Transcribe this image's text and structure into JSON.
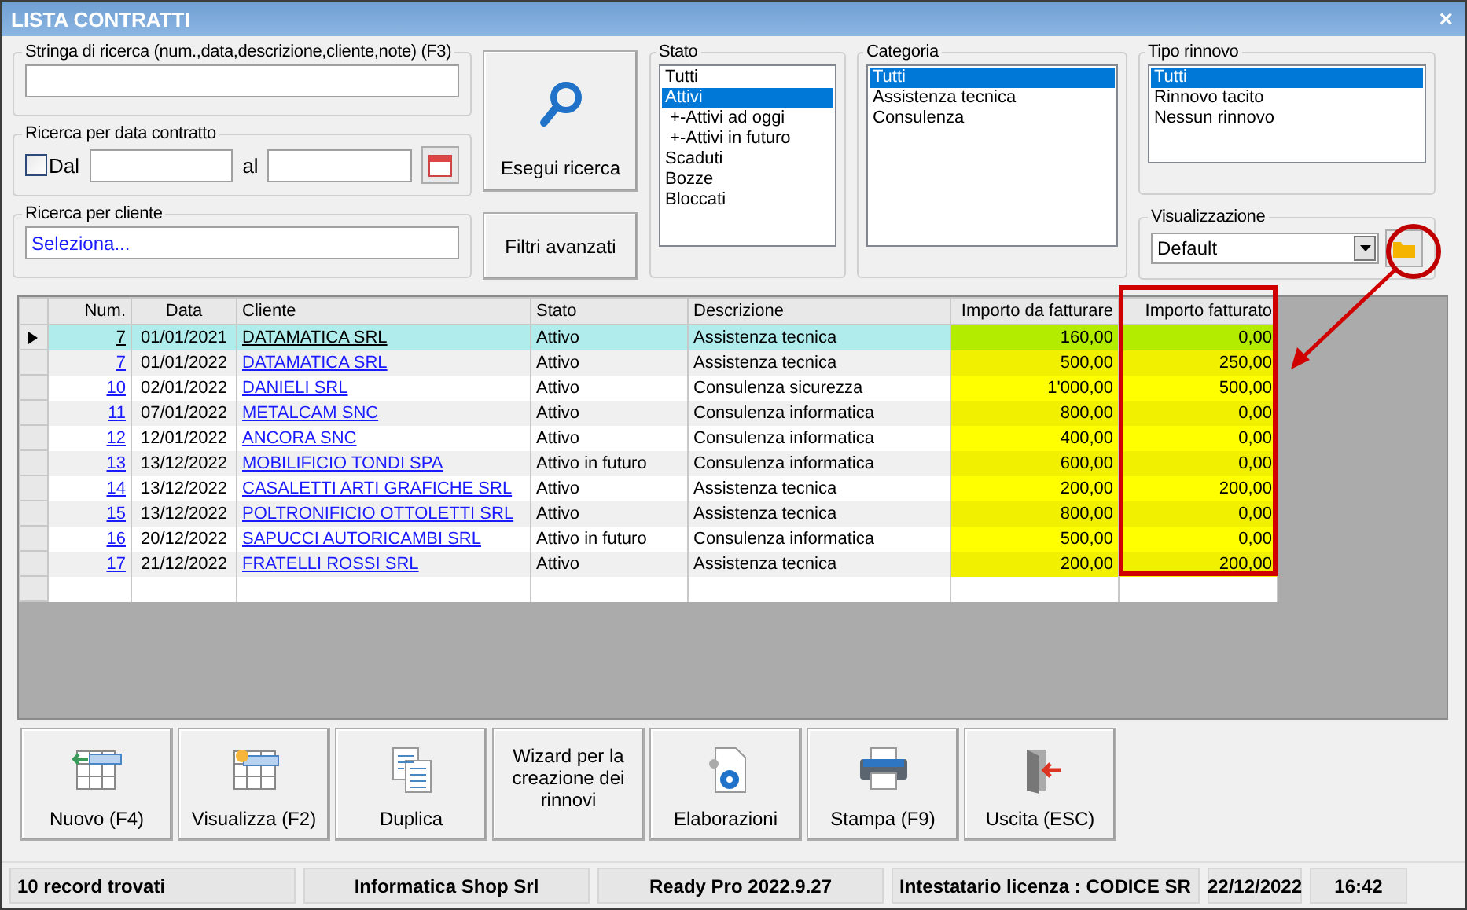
{
  "window": {
    "title": "LISTA CONTRATTI",
    "close": "×"
  },
  "search_string": {
    "label": "Stringa di ricerca (num.,data,descrizione,cliente,note) (F3)"
  },
  "date_search": {
    "label": "Ricerca per data contratto",
    "from_label": "Dal",
    "from_checked": false,
    "to_label": "al"
  },
  "client_search": {
    "label": "Ricerca per cliente",
    "value": "Seleziona..."
  },
  "search_button": "Esegui ricerca",
  "filters_button": "Filtri avanzati",
  "lists": [
    {
      "label": "Stato",
      "items": [
        {
          "label": "Tutti",
          "selected": false
        },
        {
          "label": "Attivi",
          "selected": true
        },
        {
          "label": " +-Attivi ad oggi",
          "selected": false
        },
        {
          "label": " +-Attivi in futuro",
          "selected": false
        },
        {
          "label": "Scaduti",
          "selected": false
        },
        {
          "label": "Bozze",
          "selected": false
        },
        {
          "label": "Bloccati",
          "selected": false
        }
      ]
    },
    {
      "label": "Categoria",
      "items": [
        {
          "label": "Tutti",
          "selected": true
        },
        {
          "label": "Assistenza tecnica",
          "selected": false
        },
        {
          "label": "Consulenza",
          "selected": false
        }
      ]
    },
    {
      "label": "Tipo rinnovo",
      "items": [
        {
          "label": "Tutti",
          "selected": true
        },
        {
          "label": "Rinnovo tacito",
          "selected": false
        },
        {
          "label": "Nessun rinnovo",
          "selected": false
        }
      ]
    }
  ],
  "view": {
    "label": "Visualizzazione",
    "value": "Default"
  },
  "table": {
    "columns": [
      "Num.",
      "Data",
      "Cliente",
      "Stato",
      "Descrizione",
      "Importo da fatturare",
      "Importo fatturato"
    ],
    "rows": [
      {
        "num": "7",
        "date": "01/01/2021",
        "client": "DATAMATICA SRL",
        "status": "Attivo",
        "description": "Assistenza tecnica",
        "to_invoice": "160,00",
        "invoiced": "0,00",
        "selected": true
      },
      {
        "num": "7",
        "date": "01/01/2022",
        "client": "DATAMATICA SRL",
        "status": "Attivo",
        "description": "Assistenza tecnica",
        "to_invoice": "500,00",
        "invoiced": "250,00",
        "selected": false
      },
      {
        "num": "10",
        "date": "02/01/2022",
        "client": "DANIELI SRL",
        "status": "Attivo",
        "description": "Consulenza sicurezza",
        "to_invoice": "1'000,00",
        "invoiced": "500,00",
        "selected": false
      },
      {
        "num": "11",
        "date": "07/01/2022",
        "client": "METALCAM SNC",
        "status": "Attivo",
        "description": "Consulenza informatica",
        "to_invoice": "800,00",
        "invoiced": "0,00",
        "selected": false
      },
      {
        "num": "12",
        "date": "12/01/2022",
        "client": "ANCORA SNC",
        "status": "Attivo",
        "description": "Consulenza informatica",
        "to_invoice": "400,00",
        "invoiced": "0,00",
        "selected": false
      },
      {
        "num": "13",
        "date": "13/12/2022",
        "client": "MOBILIFICIO TONDI SPA",
        "status": "Attivo in futuro",
        "description": "Consulenza informatica",
        "to_invoice": "600,00",
        "invoiced": "0,00",
        "selected": false
      },
      {
        "num": "14",
        "date": "13/12/2022",
        "client": "CASALETTI ARTI GRAFICHE SRL",
        "status": "Attivo",
        "description": "Assistenza tecnica",
        "to_invoice": "200,00",
        "invoiced": "200,00",
        "selected": false
      },
      {
        "num": "15",
        "date": "13/12/2022",
        "client": "POLTRONIFICIO OTTOLETTI SRL",
        "status": "Attivo",
        "description": "Assistenza tecnica",
        "to_invoice": "800,00",
        "invoiced": "0,00",
        "selected": false
      },
      {
        "num": "16",
        "date": "20/12/2022",
        "client": "SAPUCCI AUTORICAMBI SRL",
        "status": "Attivo in futuro",
        "description": "Consulenza informatica",
        "to_invoice": "500,00",
        "invoiced": "0,00",
        "selected": false
      },
      {
        "num": "17",
        "date": "21/12/2022",
        "client": "FRATELLI ROSSI SRL",
        "status": "Attivo",
        "description": "Assistenza tecnica",
        "to_invoice": "200,00",
        "invoiced": "200,00",
        "selected": false
      }
    ]
  },
  "actions": [
    {
      "label": "Nuovo (F4)",
      "kind": "new"
    },
    {
      "label": "Visualizza (F2)",
      "kind": "view"
    },
    {
      "label": "Duplica",
      "kind": "duplicate"
    },
    {
      "label": "Wizard per la creazione dei rinnovi",
      "kind": "text"
    },
    {
      "label": "Elaborazioni",
      "kind": "process"
    },
    {
      "label": "Stampa (F9)",
      "kind": "print"
    },
    {
      "label": "Uscita (ESC)",
      "kind": "exit"
    }
  ],
  "status_bar": [
    "10 record trovati",
    "Informatica Shop Srl",
    "Ready Pro 2022.9.27",
    "Intestatario licenza : CODICE SR",
    "22/12/2022",
    "16:42"
  ]
}
